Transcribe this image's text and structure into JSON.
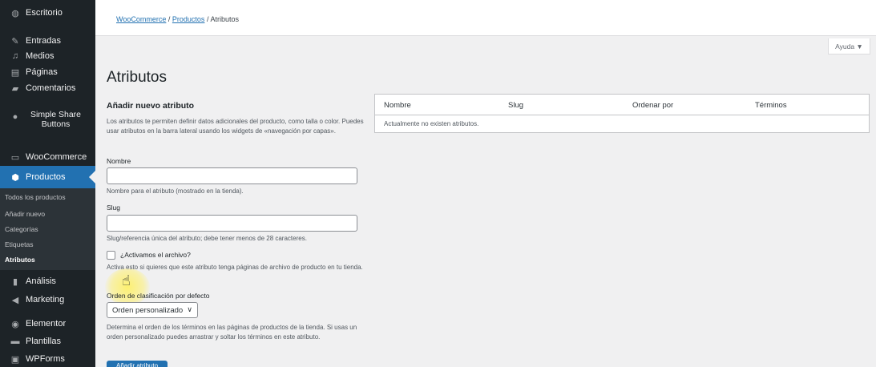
{
  "sidebar": {
    "items": [
      {
        "label": "Escritorio",
        "icon": "dashboard-icon"
      },
      {
        "label": "Entradas",
        "icon": "pin-icon"
      },
      {
        "label": "Medios",
        "icon": "media-icon"
      },
      {
        "label": "Páginas",
        "icon": "pages-icon"
      },
      {
        "label": "Comentarios",
        "icon": "comments-icon"
      },
      {
        "label": "Simple Share",
        "label2": "Buttons",
        "icon": "share-icon"
      },
      {
        "label": "WooCommerce",
        "icon": "woocommerce-icon"
      },
      {
        "label": "Productos",
        "icon": "products-icon"
      },
      {
        "label": "Análisis",
        "icon": "analytics-icon"
      },
      {
        "label": "Marketing",
        "icon": "megaphone-icon"
      },
      {
        "label": "Elementor",
        "icon": "elementor-icon"
      },
      {
        "label": "Plantillas",
        "icon": "folder-icon"
      },
      {
        "label": "WPForms",
        "icon": "forms-icon"
      }
    ],
    "submenu": [
      "Todos los productos",
      "Añadir nuevo",
      "Categorías",
      "Etiquetas",
      "Atributos"
    ],
    "accent": "#2271b1"
  },
  "header": {
    "breadcrumb": [
      "WooCommerce",
      "Productos",
      "Atributos"
    ],
    "separator": "/",
    "help": "Ayuda ▼"
  },
  "page": {
    "title": "Atributos"
  },
  "form": {
    "title": "Añadir nuevo atributo",
    "intro": "Los atributos te permiten definir datos adicionales del producto, como talla o color. Puedes usar atributos en la barra lateral usando los widgets de «navegación por capas».",
    "name_label": "Nombre",
    "name_value": "",
    "name_help": "Nombre para el atributo (mostrado en la tienda).",
    "slug_label": "Slug",
    "slug_value": "",
    "slug_help": "Slug/referencia única del atributo; debe tener menos de 28 caracteres.",
    "archive_label": "¿Activamos el archivo?",
    "archive_help": "Activa esto si quieres que este atributo tenga páginas de archivo de producto en tu tienda.",
    "order_label": "Orden de clasificación por defecto",
    "order_value": "Orden personalizado",
    "order_help": "Determina el orden de los términos en las páginas de productos de la tienda. Si usas un orden personalizado puedes arrastrar y soltar los términos en este atributo.",
    "submit": "Añadir atributo"
  },
  "table": {
    "columns": [
      "Nombre",
      "Slug",
      "Ordenar por",
      "Términos"
    ],
    "empty": "Actualmente no existen atributos."
  }
}
